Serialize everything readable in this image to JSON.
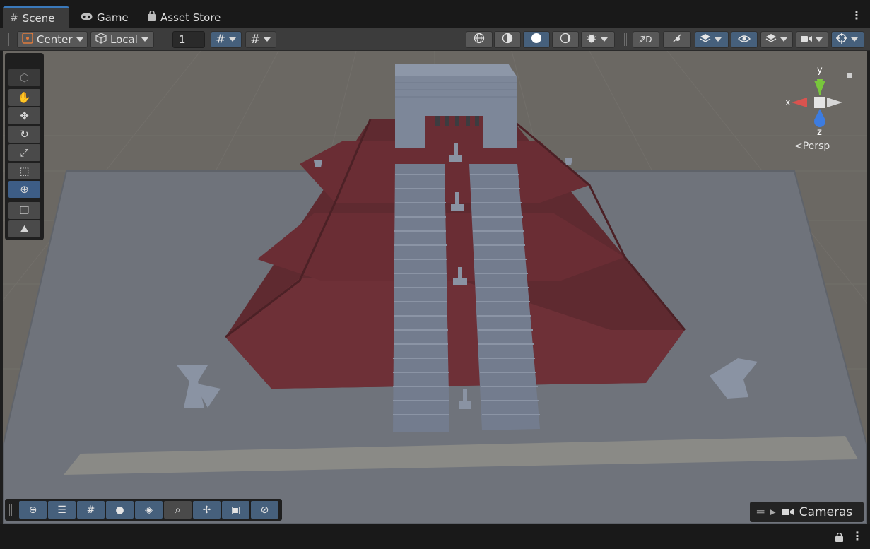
{
  "tabs": [
    {
      "label": "Scene",
      "icon": "grid-icon",
      "active": true
    },
    {
      "label": "Game",
      "icon": "gamepad-icon",
      "active": false
    },
    {
      "label": "Asset Store",
      "icon": "store-bag-icon",
      "active": false
    }
  ],
  "toolbar": {
    "pivot_mode": "Center",
    "pivot_rotation": "Local",
    "grid_snap_value": "1"
  },
  "gizmo": {
    "y_label": "y",
    "x_label": "x",
    "z_label": "z",
    "projection": "Persp"
  },
  "overlays": {
    "cameras_label": "Cameras"
  },
  "colors": {
    "selected_blue": "#46607c",
    "floor": "#6a6762",
    "red_tier": "#6b2e33",
    "stone": "#7a8597"
  }
}
